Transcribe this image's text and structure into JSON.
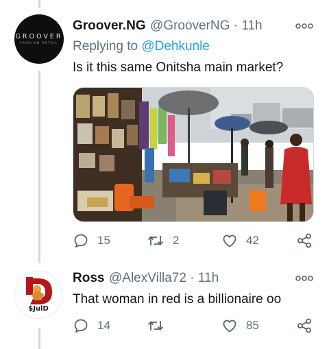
{
  "tweets": [
    {
      "display_name": "Groover.NG",
      "handle": "@GrooverNG",
      "separator": "·",
      "time": "11h",
      "reply_prefix": "Replying to ",
      "reply_to": "@Dehkunle",
      "text": "Is it this same Onitsha main market?",
      "avatar_brand": "GROOVER",
      "avatar_sub": "FASHION RETAIL",
      "media": "photo of a busy open-air market with umbrellas and stalls",
      "stats": {
        "replies": "15",
        "retweets": "2",
        "likes": "42"
      }
    },
    {
      "display_name": "Ross",
      "handle": "@AlexVilla72",
      "separator": "·",
      "time": "11h",
      "text": "That woman in red is a billionaire oo",
      "avatar_tag": "$JulD",
      "stats": {
        "replies": "14",
        "retweets": "",
        "likes": "85"
      }
    }
  ],
  "colors": {
    "accent": "#1da1f2",
    "secondary_text": "#5b7083",
    "icon": "#536471",
    "thread_line": "#cfd9de"
  }
}
